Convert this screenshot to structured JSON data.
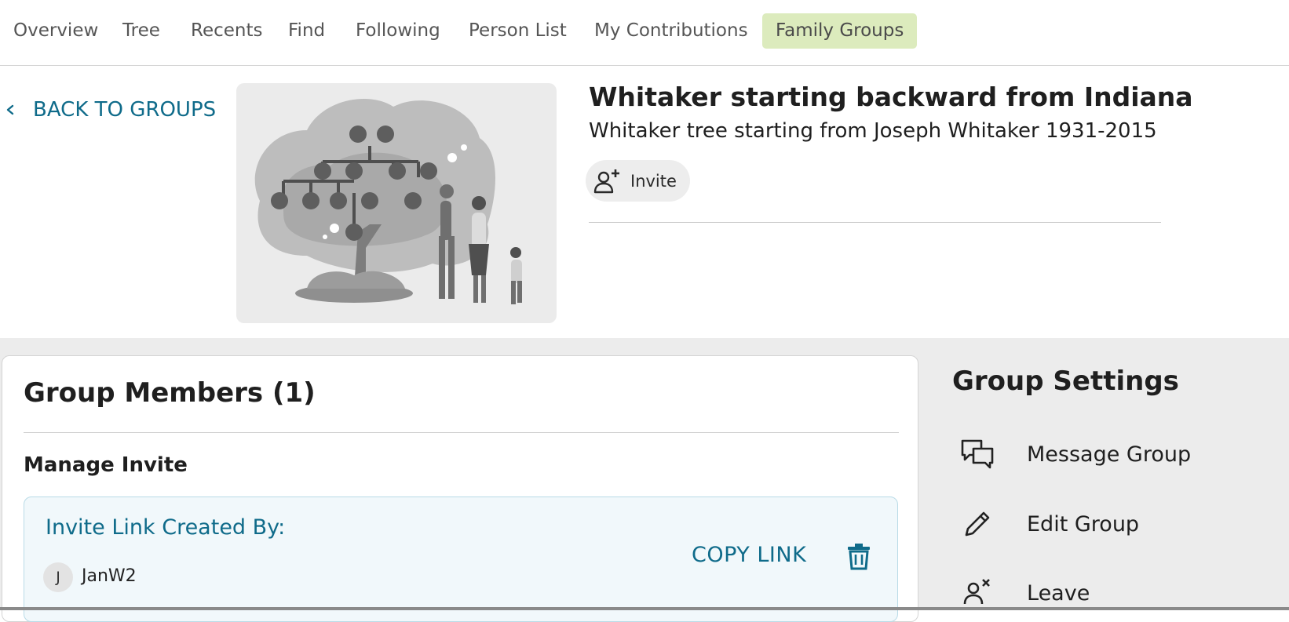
{
  "nav": {
    "tabs": [
      {
        "label": "Overview"
      },
      {
        "label": "Tree"
      },
      {
        "label": "Recents"
      },
      {
        "label": "Find"
      },
      {
        "label": "Following"
      },
      {
        "label": "Person List"
      },
      {
        "label": "My Contributions"
      },
      {
        "label": "Family Groups",
        "active": true
      }
    ]
  },
  "header": {
    "back_label": "BACK TO GROUPS",
    "title": "Whitaker starting backward from Indiana",
    "description": "Whitaker tree starting from Joseph Whitaker 1931-2015",
    "invite_label": "Invite",
    "hero_image": "family-tree-illustration"
  },
  "members": {
    "title": "Group Members (1)",
    "manage_invite_label": "Manage Invite",
    "invite_created_label": "Invite Link Created By:",
    "copy_link_label": "COPY LINK",
    "creator": {
      "initial": "J",
      "name": "JanW2"
    }
  },
  "settings": {
    "title": "Group Settings",
    "items": [
      {
        "label": "Message Group",
        "icon": "message-icon"
      },
      {
        "label": "Edit Group",
        "icon": "pencil-icon"
      },
      {
        "label": "Leave",
        "icon": "leave-person-icon"
      }
    ]
  },
  "colors": {
    "accent": "#0f6b8a",
    "active_tab": "#dcebbd",
    "lower_bg": "#ececec",
    "invite_box_bg": "#f1f8fb"
  }
}
